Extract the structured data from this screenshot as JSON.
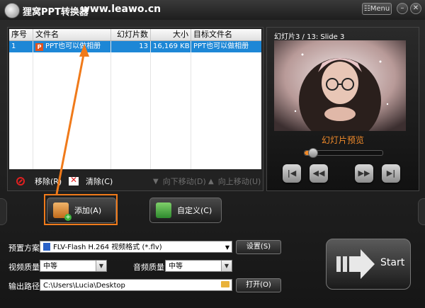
{
  "window": {
    "title_cn": "狸窝PPT转换器",
    "title_url": "www.leawo.cn",
    "menu_label": "Menu",
    "min_symbol": "–",
    "close_symbol": "✕",
    "icon": "app-logo-icon"
  },
  "file_table": {
    "columns": [
      "序号",
      "文件名",
      "幻灯片数",
      "大小",
      "目标文件名"
    ],
    "rows": [
      {
        "index": "1",
        "file_name": "PPT也可以做相册",
        "slides": "13",
        "size": "16,169 KB",
        "target": "PPT也可以做相册"
      }
    ],
    "selected_row_color": "#1d87d6"
  },
  "list_actions": {
    "remove": "移除(R)",
    "clear": "清除(C)",
    "move_down": "向下移动(D)",
    "move_up": "向上移动(U)"
  },
  "preview": {
    "slide_label": "幻灯片3 / 13: Slide 3",
    "caption": "幻灯片预览",
    "slider_position": 0.1,
    "buttons": [
      "first-icon",
      "rewind-icon",
      "forward-icon",
      "last-icon"
    ]
  },
  "buttons": {
    "add": "添加(A)",
    "custom": "自定义(C)",
    "start": "Start",
    "settings": "设置(S)",
    "open": "打开(O)"
  },
  "settings": {
    "preset_label": "预置方案:",
    "preset_value": "FLV-Flash H.264 视频格式 (*.flv)",
    "video_quality_label": "视频质量:",
    "video_quality_value": "中等",
    "audio_quality_label": "音频质量:",
    "audio_quality_value": "中等",
    "output_label": "输出路径:",
    "output_value": "C:\\Users\\Lucia\\Desktop"
  },
  "colors": {
    "accent": "#f07a1a",
    "selection": "#1d87d6",
    "background": "#1b1b1b"
  }
}
